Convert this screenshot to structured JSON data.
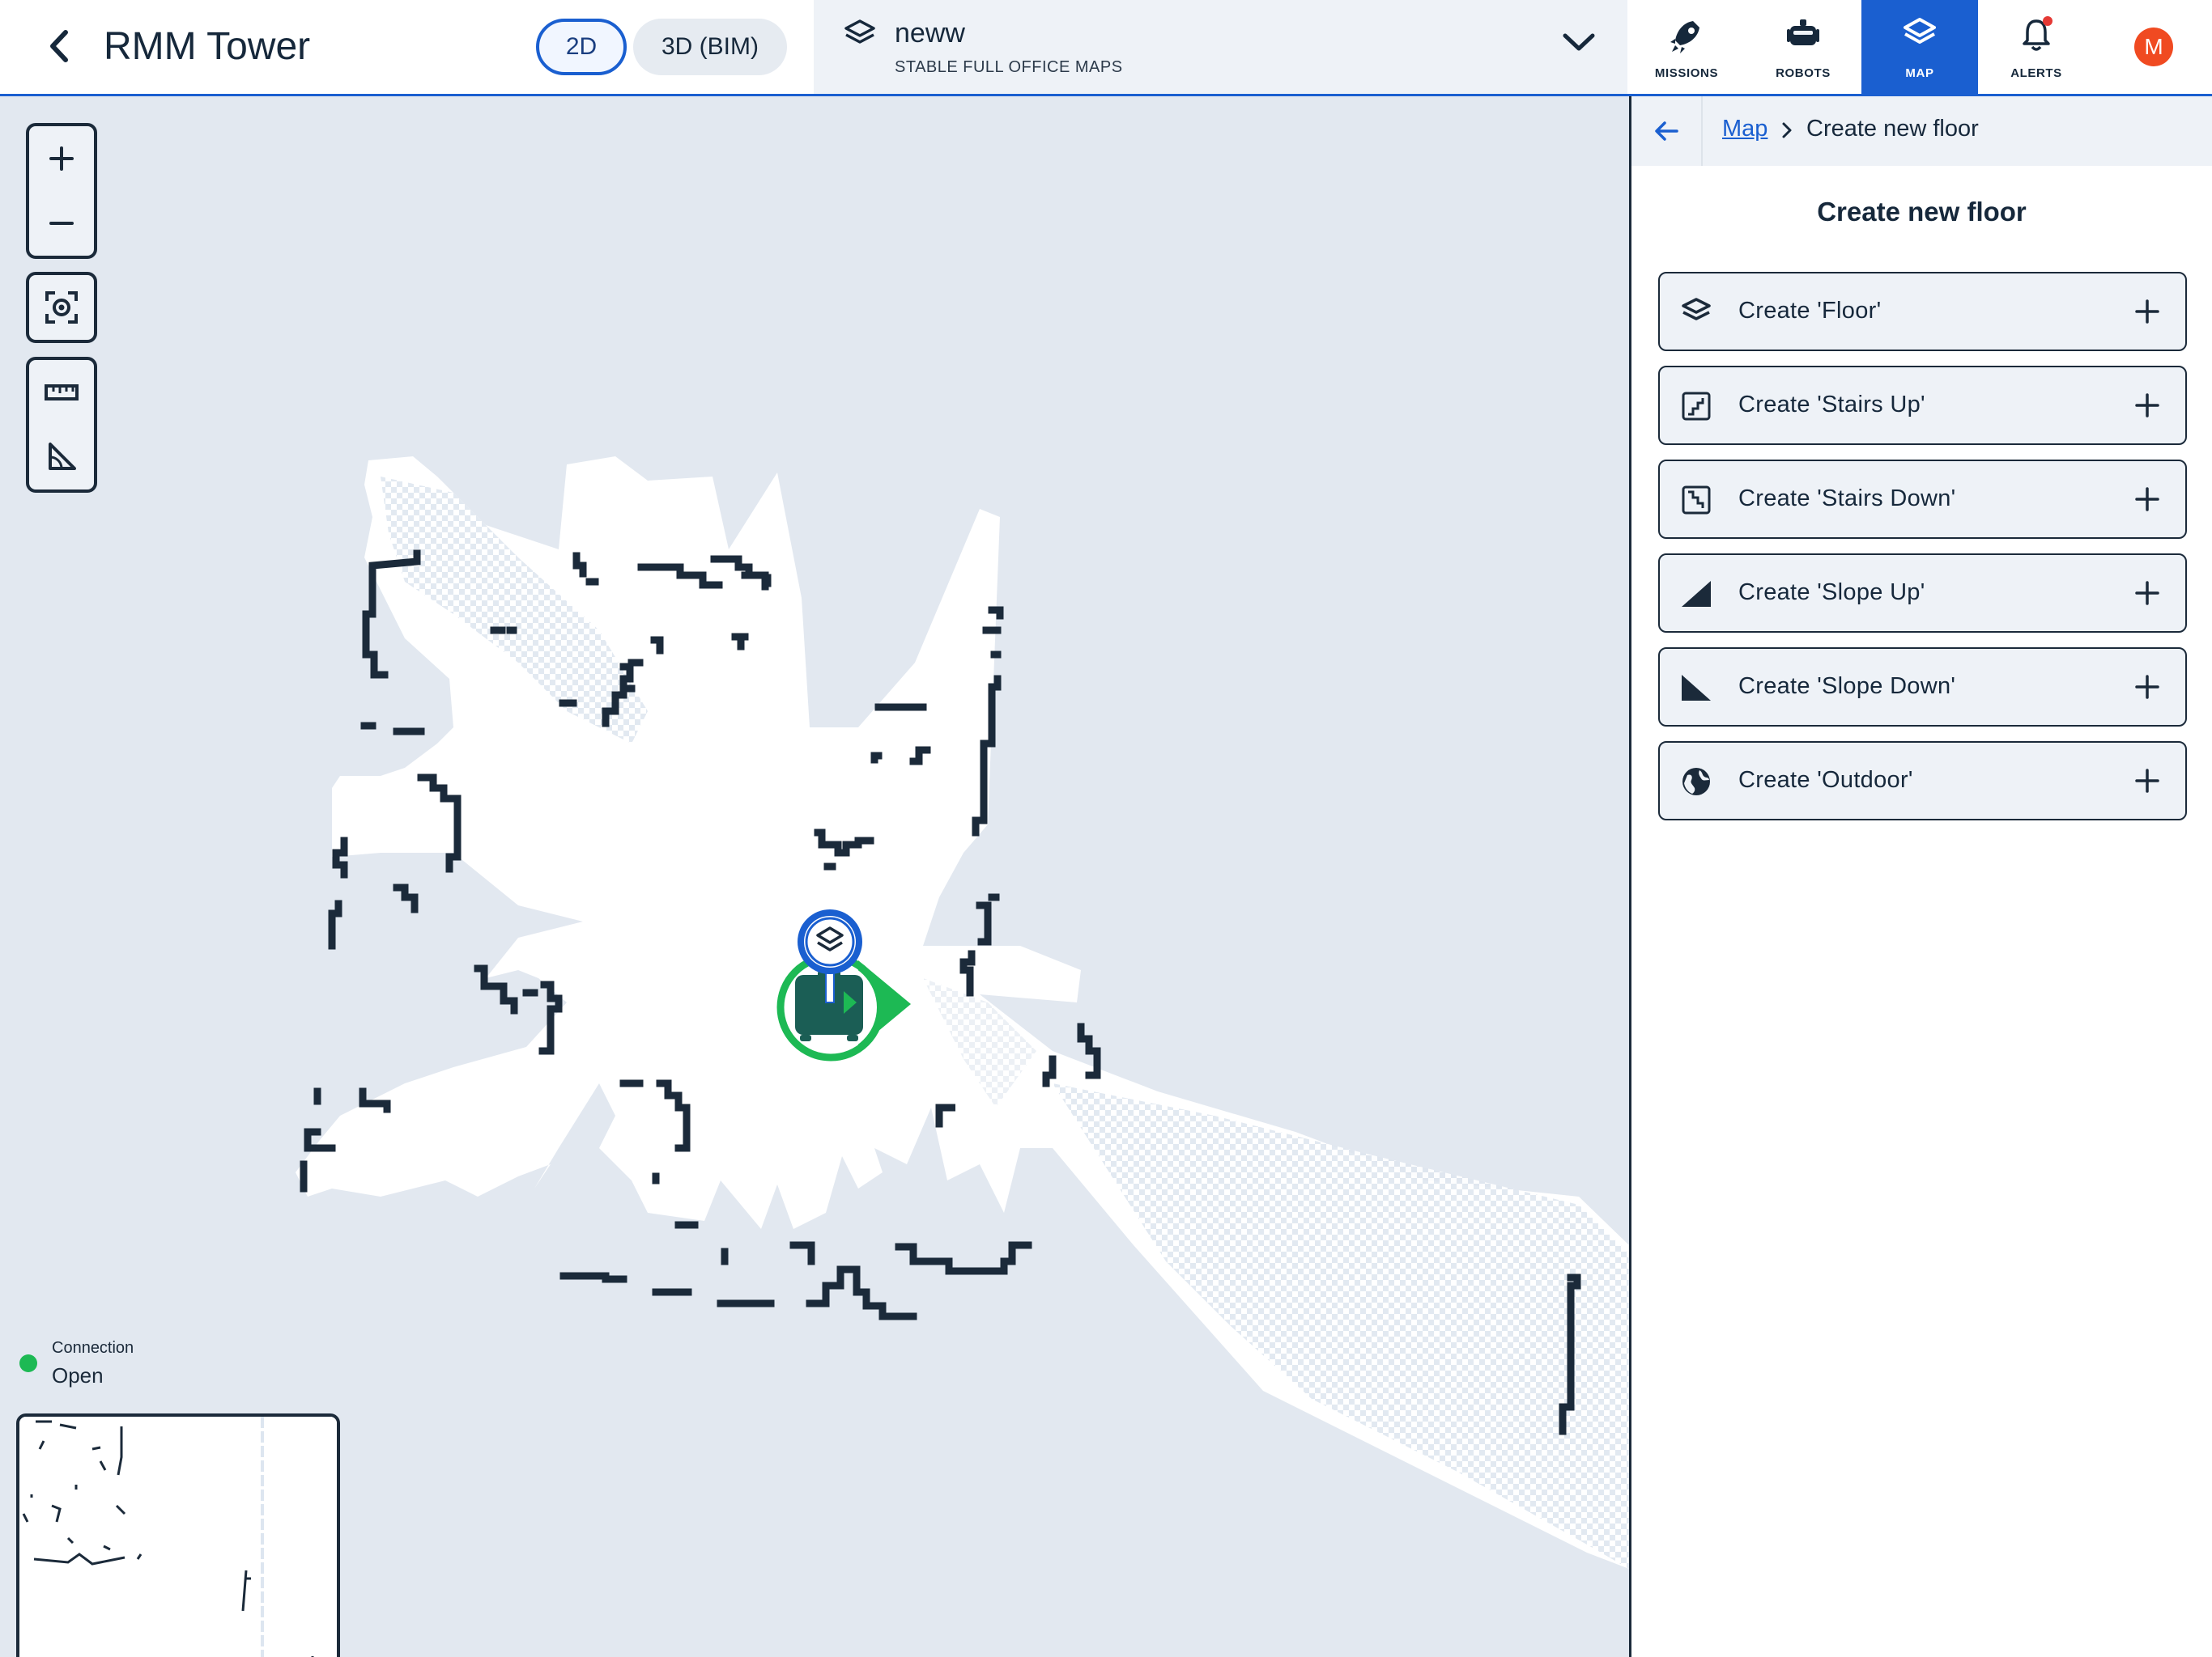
{
  "header": {
    "title": "RMM Tower",
    "view_toggle": {
      "option_2d": "2D",
      "option_3d": "3D (BIM)",
      "selected": "2D"
    },
    "map_selector": {
      "name": "neww",
      "subtitle": "STABLE FULL OFFICE MAPS",
      "icon": "layers-icon"
    },
    "nav": [
      {
        "label": "MISSIONS",
        "icon": "rocket-icon"
      },
      {
        "label": "ROBOTS",
        "icon": "robot-icon"
      },
      {
        "label": "MAP",
        "icon": "layers-icon",
        "active": true
      },
      {
        "label": "ALERTS",
        "icon": "bell-icon",
        "has_alert": true
      }
    ],
    "avatar_initial": "M",
    "colors": {
      "accent": "#1a5fd0",
      "avatar": "#f04a21",
      "alert_dot": "#e53935"
    }
  },
  "map": {
    "tools": [
      "zoom-in-icon",
      "zoom-out-icon",
      "fit-view-icon",
      "ruler-icon",
      "angle-icon"
    ],
    "connection": {
      "label": "Connection",
      "value": "Open",
      "status_color": "#1db954"
    },
    "robot_marker_color": "#1db954",
    "waypoint_marker_color": "#1a5fd0"
  },
  "panel": {
    "breadcrumb": {
      "link": "Map",
      "current": "Create new floor"
    },
    "title": "Create new floor",
    "options": [
      {
        "label": "Create 'Floor'",
        "icon": "layers-icon"
      },
      {
        "label": "Create 'Stairs Up'",
        "icon": "stairs-up-icon"
      },
      {
        "label": "Create 'Stairs Down'",
        "icon": "stairs-down-icon"
      },
      {
        "label": "Create 'Slope Up'",
        "icon": "slope-up-icon"
      },
      {
        "label": "Create 'Slope Down'",
        "icon": "slope-down-icon"
      },
      {
        "label": "Create 'Outdoor'",
        "icon": "globe-icon"
      }
    ]
  }
}
